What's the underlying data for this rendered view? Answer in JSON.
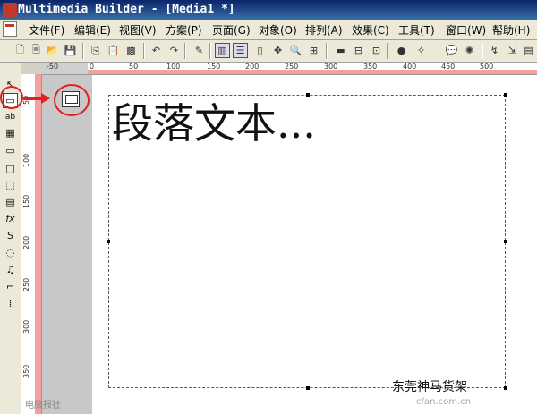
{
  "window": {
    "title": "Multimedia Builder - [Media1 *]"
  },
  "menu": [
    {
      "label": "文件(F)"
    },
    {
      "label": "编辑(E)"
    },
    {
      "label": "视图(V)"
    },
    {
      "label": "方案(P)"
    },
    {
      "label": "页面(G)"
    },
    {
      "label": "对象(O)"
    },
    {
      "label": "排列(A)"
    },
    {
      "label": "效果(C)"
    },
    {
      "label": "工具(T)"
    },
    {
      "label": "窗口(W)"
    },
    {
      "label": "帮助(H)"
    }
  ],
  "toolbar": {
    "icons": [
      "new-icon",
      "open-icon",
      "open-folder-icon",
      "save-icon",
      "copy-icon",
      "paste-icon",
      "delete-icon",
      "undo-icon",
      "redo-icon",
      "properties-icon",
      "page-layout-icon",
      "page-list-icon",
      "page-icon",
      "move-icon",
      "zoom-icon",
      "grid-icon",
      "stop-icon",
      "wand-icon",
      "speech-icon",
      "sun-icon",
      "link-icon",
      "export-icon"
    ]
  },
  "left_tools": {
    "icons": [
      {
        "name": "select-arrow-icon",
        "glyph": "↖"
      },
      {
        "name": "paragraph-text-icon",
        "glyph": "▭"
      },
      {
        "name": "text-icon",
        "glyph": "ab"
      },
      {
        "name": "bitmap-icon",
        "glyph": "▦"
      },
      {
        "name": "rectangle-button-icon",
        "glyph": "▭"
      },
      {
        "name": "rectangle-icon",
        "glyph": "□"
      },
      {
        "name": "hotspot-icon",
        "glyph": "⬚"
      },
      {
        "name": "film-icon",
        "glyph": "▤"
      },
      {
        "name": "effect-icon",
        "glyph": "fx"
      },
      {
        "name": "script-icon",
        "glyph": "S"
      },
      {
        "name": "circle-icon",
        "glyph": "◌"
      },
      {
        "name": "sound-icon",
        "glyph": "♫"
      },
      {
        "name": "shape-icon",
        "glyph": "⌐"
      },
      {
        "name": "line-icon",
        "glyph": "⁞"
      }
    ]
  },
  "ruler": {
    "h_labels": [
      "-50",
      "0",
      "50",
      "100",
      "150",
      "200",
      "250",
      "300",
      "350",
      "400",
      "450",
      "500"
    ],
    "v_labels": [
      "50",
      "100",
      "150",
      "200",
      "250",
      "300",
      "350"
    ]
  },
  "canvas": {
    "paragraph_text": "段落文本..."
  },
  "watermark": {
    "main": "东莞神马货架",
    "sub": "cfan.com.cn",
    "left": "电脑报社"
  }
}
